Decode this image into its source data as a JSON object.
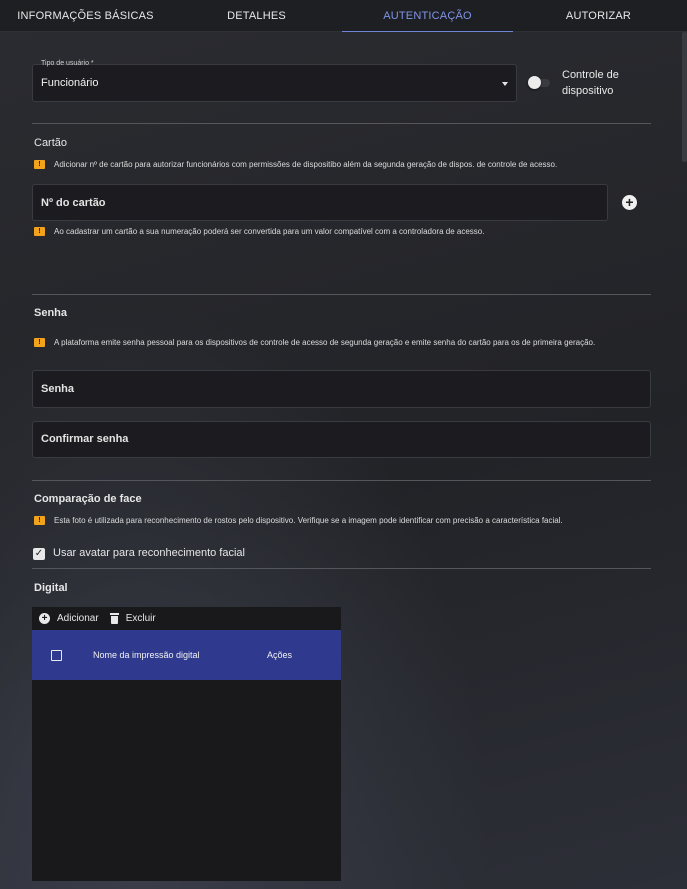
{
  "tabs": [
    {
      "label": "INFORMAÇÕES BÁSICAS"
    },
    {
      "label": "DETALHES"
    },
    {
      "label": "AUTENTICAÇÃO"
    },
    {
      "label": "AUTORIZAR"
    }
  ],
  "active_tab": "AUTENTICAÇÃO",
  "user_type": {
    "label": "Tipo de usuário *",
    "value": "Funcionário"
  },
  "device_control": {
    "label_line1": "Controle de",
    "label_line2": "dispositivo",
    "enabled": false
  },
  "card": {
    "title": "Cartão",
    "warning": "Adicionar nº de cartão para autorizar funcionários com permissões de dispositibo além da segunda geração de dispos. de controle de acesso.",
    "input_placeholder": "Nº do cartão",
    "note": "Ao cadastrar um cartão a sua numeração poderá ser convertida para um valor compatível com a controladora de acesso."
  },
  "password": {
    "title": "Senha",
    "warning": "A plataforma emite senha pessoal para os dispositivos de controle de acesso de segunda geração e emite senha do cartão para os de primeira geração.",
    "password_placeholder": "Senha",
    "confirm_placeholder": "Confirmar senha"
  },
  "face": {
    "title": "Comparação de face",
    "warning": "Esta foto é utilizada para reconhecimento de rostos pelo dispositivo. Verifique se a imagem pode identificar com precisão a característica facial.",
    "use_avatar_label": "Usar avatar para reconhecimento facial",
    "use_avatar_checked": true
  },
  "fingerprint": {
    "title": "Digital",
    "add_label": "Adicionar",
    "delete_label": "Excluir",
    "columns": [
      "Nome da impressão digital",
      "Ações"
    ],
    "rows": []
  },
  "colors": {
    "accent": "#7f95e6",
    "table_header": "#2f3a8e",
    "warning": "#f3a21b"
  },
  "icons": {
    "warning": "warning-icon",
    "add": "add-circle-icon",
    "delete": "trash-icon",
    "dropdown": "chevron-down-icon",
    "check": "checkbox-checked-icon"
  }
}
